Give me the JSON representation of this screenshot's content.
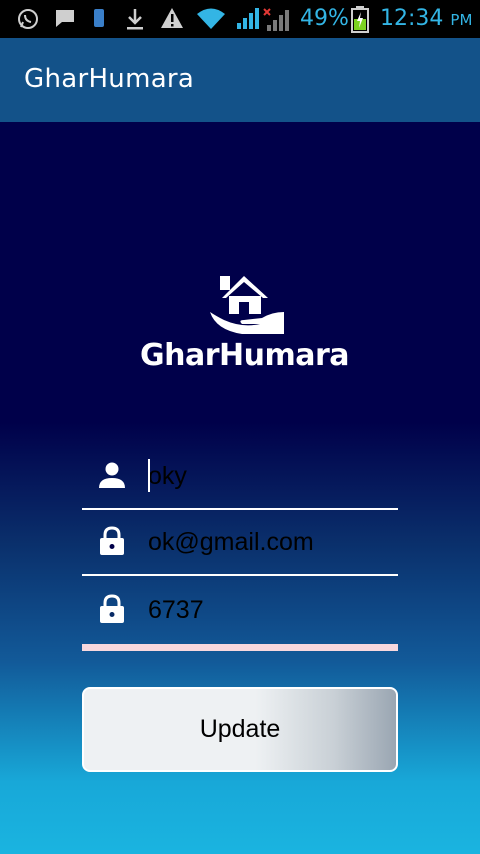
{
  "status_bar": {
    "battery_percent": "49%",
    "time": "12:34",
    "ampm": "PM"
  },
  "app_bar": {
    "title": "GharHumara"
  },
  "logo": {
    "text": "GharHumara"
  },
  "form": {
    "name_value": "oky",
    "email_value": "ok@gmail.com",
    "phone_value": "6737",
    "update_label": "Update"
  },
  "colors": {
    "app_bar": "#135289",
    "background_top": "#00004a",
    "background_bottom": "#1ab4e0",
    "status_accent": "#33b5e5",
    "active_underline": "#f7d8de"
  }
}
